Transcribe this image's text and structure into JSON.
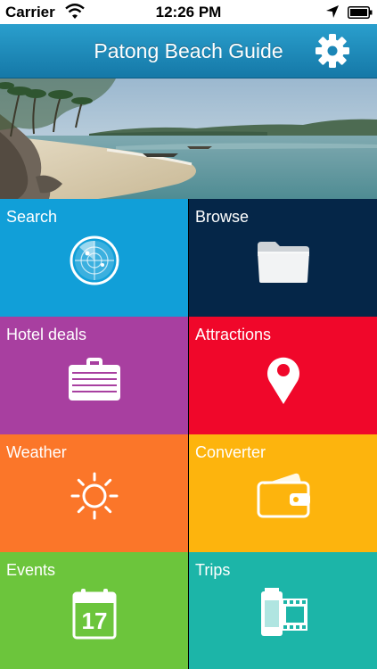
{
  "status_bar": {
    "carrier": "Carrier",
    "time": "12:26 PM"
  },
  "nav": {
    "title": "Patong Beach Guide",
    "settings_icon": "gear-icon"
  },
  "hero": {
    "icon": "beach-photo"
  },
  "tiles": [
    {
      "label": "Search",
      "icon": "radar-icon",
      "color": "#119fd8"
    },
    {
      "label": "Browse",
      "icon": "folder-icon",
      "color": "#052648"
    },
    {
      "label": "Hotel deals",
      "icon": "suitcase-icon",
      "color": "#a83fa0"
    },
    {
      "label": "Attractions",
      "icon": "map-pin-icon",
      "color": "#f0072a"
    },
    {
      "label": "Weather",
      "icon": "sun-icon",
      "color": "#fb7629"
    },
    {
      "label": "Converter",
      "icon": "wallet-icon",
      "color": "#fdb40d"
    },
    {
      "label": "Events",
      "icon": "calendar-icon",
      "color": "#6cc53c",
      "calendar_day": "17"
    },
    {
      "label": "Trips",
      "icon": "film-roll-icon",
      "color": "#1cb5a8"
    }
  ]
}
